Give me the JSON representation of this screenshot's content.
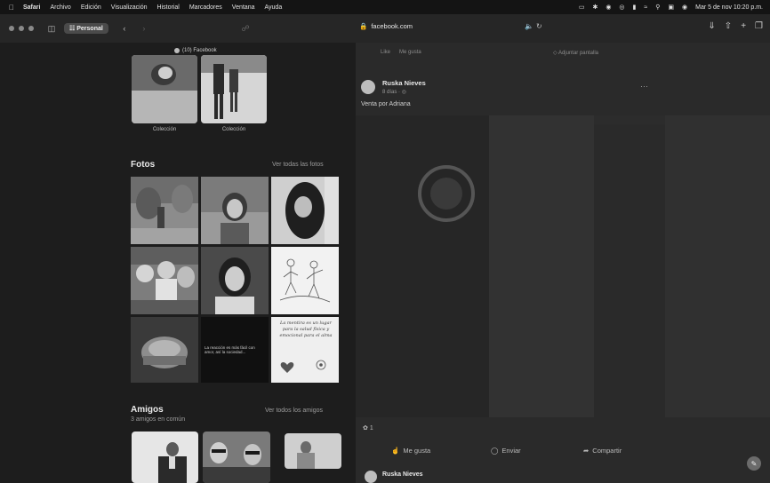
{
  "menubar": {
    "apple_icon": "apple-icon",
    "app": "Safari",
    "items": [
      "Archivo",
      "Edición",
      "Visualización",
      "Historial",
      "Marcadores",
      "Ventana",
      "Ayuda"
    ],
    "datetime": "Mar 5 de nov  10:20 p.m."
  },
  "toolbar": {
    "profile": "Personal",
    "url": "facebook.com",
    "tab_title": "(10) Facebook"
  },
  "collections": [
    {
      "label": "Colección"
    },
    {
      "label": "Colección"
    }
  ],
  "photos": {
    "title": "Fotos",
    "see_all": "Ver todas las fotos",
    "tile_text_8": "La reacción es más fácil con amor, así la sociedad...",
    "tile_text_9": "La mentira es un lugar para la salud física y emocional para el alma"
  },
  "friends": {
    "title": "Amigos",
    "subtitle": "3 amigos en común",
    "see_all": "Ver todos los amigos"
  },
  "post": {
    "like_label": "Like",
    "reply_label": "Me gusta",
    "pin_label": "Adjuntar pantalla",
    "author": "Ruska Nieves",
    "meta": "8 días · ",
    "caption": "Venta por Adriana",
    "reactions_count": "1",
    "actions": {
      "like": "Me gusta",
      "send": "Enviar",
      "share": "Compartir"
    },
    "next_author": "Ruska Nieves"
  }
}
